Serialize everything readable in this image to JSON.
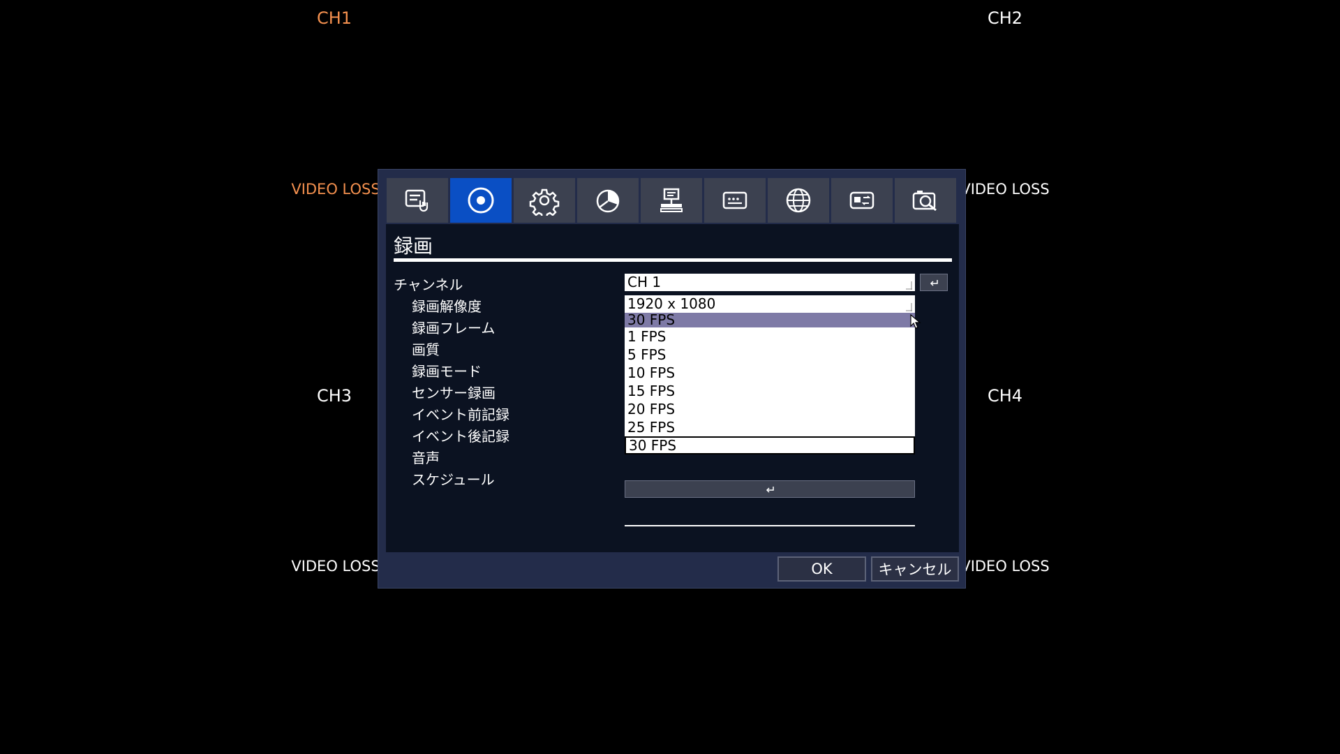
{
  "channels": {
    "ch1": "CH1",
    "ch2": "CH2",
    "ch3": "CH3",
    "ch4": "CH4",
    "video_loss": "VIDEO LOSS"
  },
  "tabs": [
    {
      "icon": "quick-setup-icon",
      "active": false
    },
    {
      "icon": "record-icon",
      "active": true
    },
    {
      "icon": "settings-gear-icon",
      "active": false
    },
    {
      "icon": "chart-icon",
      "active": false
    },
    {
      "icon": "network-pc-icon",
      "active": false
    },
    {
      "icon": "display-icon",
      "active": false
    },
    {
      "icon": "globe-icon",
      "active": false
    },
    {
      "icon": "storage-icon",
      "active": false
    },
    {
      "icon": "search-icon",
      "active": false
    }
  ],
  "panel": {
    "title": "録画"
  },
  "rows": {
    "channel": {
      "label": "チャンネル",
      "value": "CH 1"
    },
    "resolution": {
      "label": "録画解像度",
      "value": "1920 x 1080"
    },
    "frame": {
      "label": "録画フレーム",
      "value": "30 FPS"
    },
    "quality": {
      "label": "画質"
    },
    "mode": {
      "label": "録画モード"
    },
    "sensor": {
      "label": "センサー録画"
    },
    "pre_event": {
      "label": "イベント前記録"
    },
    "post_event": {
      "label": "イベント後記録"
    },
    "audio": {
      "label": "音声"
    },
    "schedule": {
      "label": "スケジュール"
    }
  },
  "frame_options": [
    "1 FPS",
    "5 FPS",
    "10 FPS",
    "15 FPS",
    "20 FPS",
    "25 FPS",
    "30 FPS"
  ],
  "frame_selected": "30 FPS",
  "buttons": {
    "ok": "OK",
    "cancel": "キャンセル"
  },
  "colors": {
    "active_tab": "#0a4fc4",
    "channel_accent": "#f5914f",
    "dialog_bg": "#232c4a",
    "panel_bg": "#0b1221",
    "open_field": "#7e7aa6"
  }
}
